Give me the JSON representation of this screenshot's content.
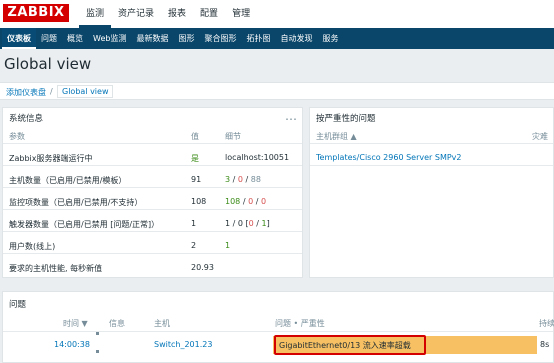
{
  "brand": {
    "logo_text": "ZABBIX",
    "logo_color": "#d40000"
  },
  "top_menu": [
    "监测",
    "资产记录",
    "报表",
    "配置",
    "管理"
  ],
  "sub_nav": [
    "仪表板",
    "问题",
    "概览",
    "Web监测",
    "最新数据",
    "图形",
    "聚合图形",
    "拓扑图",
    "自动发现",
    "服务"
  ],
  "page": {
    "title": "Global view"
  },
  "breadcrumb": {
    "root": "添加仪表盘",
    "separator": "/",
    "current": "Global view"
  },
  "sysinfo": {
    "title": "系统信息",
    "menu_icon": "…",
    "headers": {
      "param": "参数",
      "value": "值",
      "detail": "细节"
    },
    "rows": [
      {
        "param": "Zabbix服务器端运行中",
        "value": "是",
        "detail": "localhost:10051"
      },
      {
        "param": "主机数量（已启用/已禁用/模板）",
        "value": "91",
        "d1": "3",
        "d2": "0",
        "d3": "88"
      },
      {
        "param": "监控项数量（已启用/已禁用/不支持）",
        "value": "108",
        "d1": "108",
        "d2": "0",
        "d3": "0"
      },
      {
        "param": "触发器数量（已启用/已禁用 [问题/正常]）",
        "value": "1",
        "d1": "1 / 0 [",
        "d2": "0",
        "d3": "1",
        "d4": "]"
      },
      {
        "param": "用户数(线上)",
        "value": "2",
        "d1": "1"
      },
      {
        "param": "要求的主机性能, 每秒新值",
        "value": "20.93"
      }
    ]
  },
  "problems_by_severity": {
    "title": "按严重性的问题",
    "headers": {
      "group": "主机群组 ▲",
      "disaster": "灾难"
    },
    "rows": [
      {
        "group": "Templates/Cisco 2960 Server SMPv2"
      }
    ]
  },
  "problems": {
    "title": "问题",
    "headers": {
      "time": "时间 ▼",
      "info": "信息",
      "host": "主机",
      "problem": "问题 • 严重性",
      "duration": "持续"
    },
    "rows": [
      {
        "time": "14:00:38",
        "host": "Switch_201.23",
        "problem": "GigabitEthernet0/13 流入速率超载",
        "duration": "8s"
      }
    ]
  },
  "colors": {
    "nav_bg": "#0a466a",
    "average_severity": "#f7c163",
    "highlight_box": "#d40000",
    "link": "#0275b8",
    "ok_green": "#3a8b17",
    "red": "#d64e4e"
  }
}
